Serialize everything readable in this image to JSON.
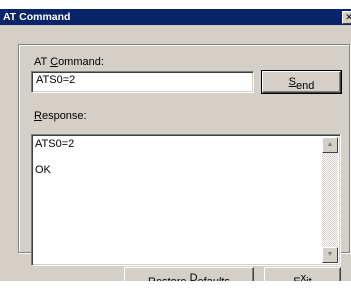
{
  "window": {
    "title": "AT Command",
    "close_glyph": "✕"
  },
  "command": {
    "label_pre": "AT ",
    "label_accel": "C",
    "label_post": "ommand:",
    "value": "ATS0=2",
    "send_pre": "",
    "send_accel": "S",
    "send_post": "end"
  },
  "response": {
    "label_accel": "R",
    "label_post": "esponse:",
    "lines": [
      "ATS0=2",
      "OK"
    ],
    "scroll_up": "▲",
    "scroll_down": "▼"
  },
  "footer": {
    "restore_pre": "Restore ",
    "restore_accel": "D",
    "restore_post": "efaults",
    "exit_pre": "E",
    "exit_accel": "x",
    "exit_post": "it"
  }
}
